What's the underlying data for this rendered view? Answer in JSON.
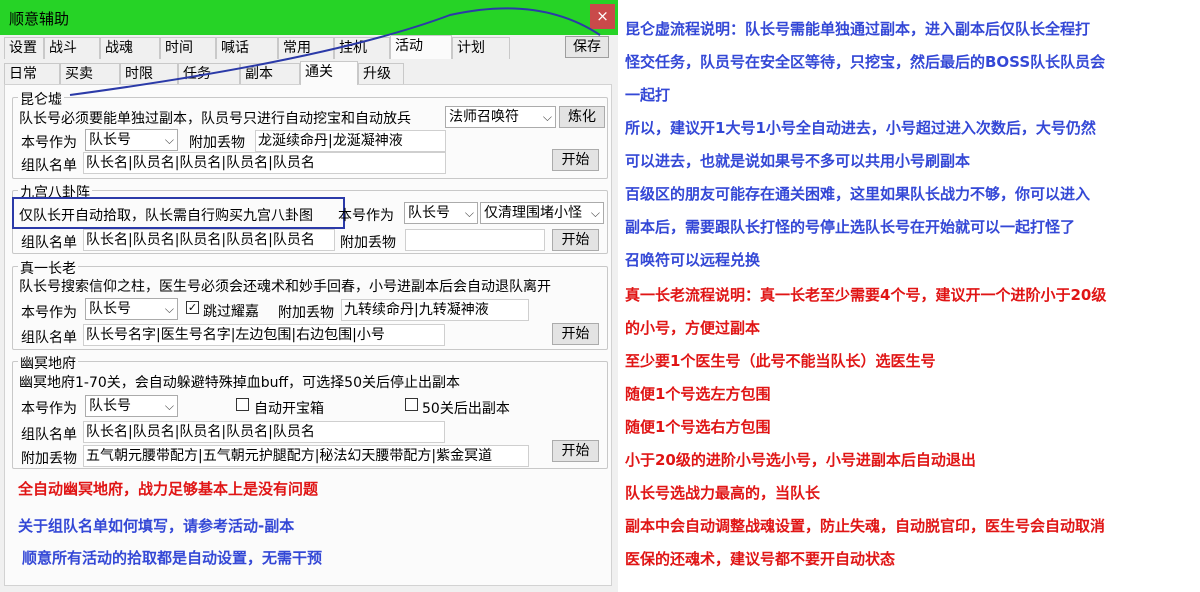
{
  "window": {
    "title": "顺意辅助",
    "close_label": "×",
    "save_label": "保存"
  },
  "tabs_row1": [
    "设置",
    "战斗",
    "战魂",
    "时间",
    "喊话",
    "常用",
    "挂机",
    "活动",
    "计划"
  ],
  "tabs_row2": [
    "日常",
    "买卖",
    "时限",
    "任务",
    "副本",
    "通关",
    "升级"
  ],
  "kunlun": {
    "title": "昆仑墟",
    "desc": "队长号必须要能单独过副本，队员号只进行自动挖宝和自动放兵",
    "summon_combo": "法师召唤符",
    "refine_btn": "炼化",
    "role_label": "本号作为",
    "role_combo": "队长号",
    "items_label": "附加丢物",
    "items_value": "龙涎续命丹|龙涎凝神液",
    "team_label": "组队名单",
    "team_value": "队长名|队员名|队员名|队员名|队员名",
    "start_btn": "开始"
  },
  "bagua": {
    "title": "九宫八卦阵",
    "desc": "仅队长开自动拾取，队长需自行购买九宫八卦图",
    "role_label": "本号作为",
    "role_combo": "队长号",
    "mode_combo": "仅清理围堵小怪",
    "team_label": "组队名单",
    "team_value": "队长名|队员名|队员名|队员名|队员名",
    "items_label": "附加丢物",
    "items_value": "",
    "start_btn": "开始"
  },
  "zhenyi": {
    "title": "真一长老",
    "desc": "队长号搜索信仰之柱，医生号必须会还魂术和妙手回春，小号进副本后会自动退队离开",
    "role_label": "本号作为",
    "role_combo": "队长号",
    "skip_label": "跳过耀嘉",
    "skip_checked": true,
    "items_label": "附加丢物",
    "items_value": "九转续命丹|九转凝神液",
    "team_label": "组队名单",
    "team_value": "队长号名字|医生号名字|左边包围|右边包围|小号",
    "start_btn": "开始"
  },
  "youming": {
    "title": "幽冥地府",
    "desc": "幽冥地府1-70关，会自动躲避特殊掉血buff，可选择50关后停止出副本",
    "role_label": "本号作为",
    "role_combo": "队长号",
    "chest_label": "自动开宝箱",
    "stop50_label": "50关后出副本",
    "team_label": "组队名单",
    "team_value": "队长名|队员名|队员名|队员名|队员名",
    "items_label": "附加丢物",
    "items_value": "五气朝元腰带配方|五气朝元护腿配方|秘法幻天腰带配方|紫金冥道",
    "start_btn": "开始"
  },
  "bottom_notes": [
    "全自动幽冥地府，战力足够基本上是没有问题",
    "关于组队名单如何填写，请参考活动-副本",
    "顺意所有活动的拾取都是自动设置，无需干预"
  ],
  "right_notes_blue": [
    "昆仑虚流程说明：队长号需能单独通过副本，进入副本后仅队长全程打",
    "怪交任务，队员号在安全区等待，只挖宝，然后最后的BOSS队长队员会",
    "一起打",
    "所以，建议开1大号1小号全自动进去，小号超过进入次数后，大号仍然",
    "可以进去，也就是说如果号不多可以共用小号刷副本",
    "百级区的朋友可能存在通关困难，这里如果队长战力不够，你可以进入",
    "副本后，需要跟队长打怪的号停止选队长号在开始就可以一起打怪了",
    "召唤符可以远程兑换"
  ],
  "right_notes_red": [
    "真一长老流程说明：真一长老至少需要4个号，建议开一个进阶小于20级",
    "的小号，方便过副本",
    "至少要1个医生号（此号不能当队长）选医生号",
    "随便1个号选左方包围",
    "随便1个号选右方包围",
    "小于20级的进阶小号选小号，小号进副本后自动退出",
    "队长号选战力最高的，当队长",
    "副本中会自动调整战魂设置，防止失魂，自动脱官印，医生号会自动取消",
    "医保的还魂术，建议号都不要开自动状态"
  ]
}
